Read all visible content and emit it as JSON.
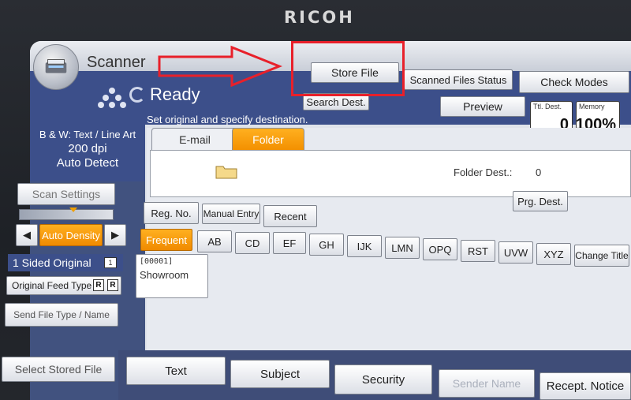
{
  "brand": "RICOH",
  "header": {
    "app_title": "Scanner",
    "store_file": "Store File",
    "scanned_files_status": "Scanned Files Status",
    "check_modes": "Check Modes"
  },
  "status": {
    "ready": "Ready",
    "message": "Set original and specify destination.",
    "search_dest": "Search Dest.",
    "preview": "Preview",
    "ttl_dest_label": "Ttl. Dest.",
    "ttl_dest_value": "0",
    "memory_label": "Memory",
    "memory_value": "100%"
  },
  "left_panel": {
    "mode_line1": "B & W: Text / Line Art",
    "mode_line2": "200 dpi",
    "mode_line3": "Auto Detect",
    "scan_settings": "Scan Settings",
    "density_left": "◀",
    "auto_density": "Auto Density",
    "density_right": "▶",
    "sided_original": "1 Sided Original",
    "sided_icon": "1",
    "original_feed_type": "Original Feed Type",
    "rr1": "R",
    "rr2": "R",
    "send_file_type": "Send File Type / Name",
    "select_stored_file": "Select Stored File"
  },
  "tabs": [
    {
      "label": "E-mail"
    },
    {
      "label": "Folder"
    }
  ],
  "destination": {
    "folder_dest_label": "Folder Dest.:",
    "folder_dest_count": "0",
    "prg_dest": "Prg. Dest."
  },
  "reg_buttons": {
    "reg_no": "Reg. No.",
    "manual_entry": "Manual Entry",
    "recent": "Recent"
  },
  "index": [
    "Frequent",
    "AB",
    "CD",
    "EF",
    "GH",
    "IJK",
    "LMN",
    "OPQ",
    "RST",
    "UVW",
    "XYZ",
    "Change Title"
  ],
  "entries": [
    {
      "code": "[00001]",
      "name": "Showroom"
    }
  ],
  "bottom_buttons": {
    "text": "Text",
    "subject": "Subject",
    "security": "Security",
    "sender_name": "Sender Name",
    "recept_notice": "Recept. Notice"
  },
  "colors": {
    "accent_orange": "#f39000",
    "status_blue": "#3c4f8a",
    "annotation_red": "#e8202a"
  }
}
